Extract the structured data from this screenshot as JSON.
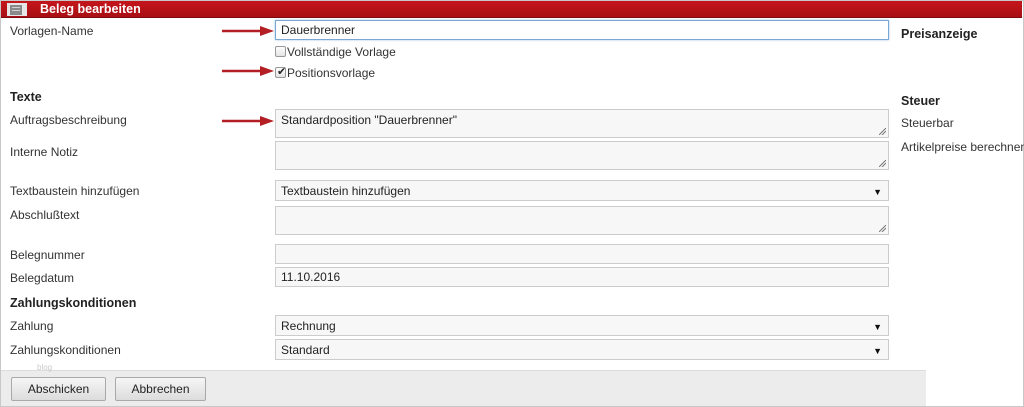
{
  "window": {
    "title": "Beleg bearbeiten",
    "icon": "document-icon"
  },
  "colors": {
    "titlebar": "#b3131a",
    "arrow": "#b21e24",
    "focus_border": "#7aa7d6"
  },
  "form": {
    "vorlagen_name": {
      "label": "Vorlagen-Name",
      "value": "Dauerbrenner"
    },
    "vollstaendige_vorlage": {
      "label": "Vollständige Vorlage",
      "checked": false
    },
    "positionsvorlage": {
      "label": "Positionsvorlage",
      "checked": true
    }
  },
  "texte": {
    "heading": "Texte",
    "auftragsbeschreibung": {
      "label": "Auftragsbeschreibung",
      "value": "Standardposition \"Dauerbrenner\""
    },
    "interne_notiz": {
      "label": "Interne Notiz",
      "value": ""
    },
    "textbaustein": {
      "label": "Textbaustein hinzufügen",
      "selected": "Textbaustein hinzufügen"
    },
    "abschlusstext": {
      "label": "Abschlußtext",
      "value": ""
    },
    "belegnummer": {
      "label": "Belegnummer",
      "value": ""
    },
    "belegdatum": {
      "label": "Belegdatum",
      "value": "11.10.2016"
    }
  },
  "zahlung": {
    "heading": "Zahlungskonditionen",
    "zahlung": {
      "label": "Zahlung",
      "selected": "Rechnung"
    },
    "zahlungskonditionen": {
      "label": "Zahlungskonditionen",
      "selected": "Standard"
    }
  },
  "right": {
    "preisanzeige": "Preisanzeige",
    "steuer": "Steuer",
    "steuerbar": "Steuerbar",
    "artikelpreise": "Artikelpreise berechnen"
  },
  "footer": {
    "submit": "Abschicken",
    "cancel": "Abbrechen",
    "watermark": "blog"
  }
}
